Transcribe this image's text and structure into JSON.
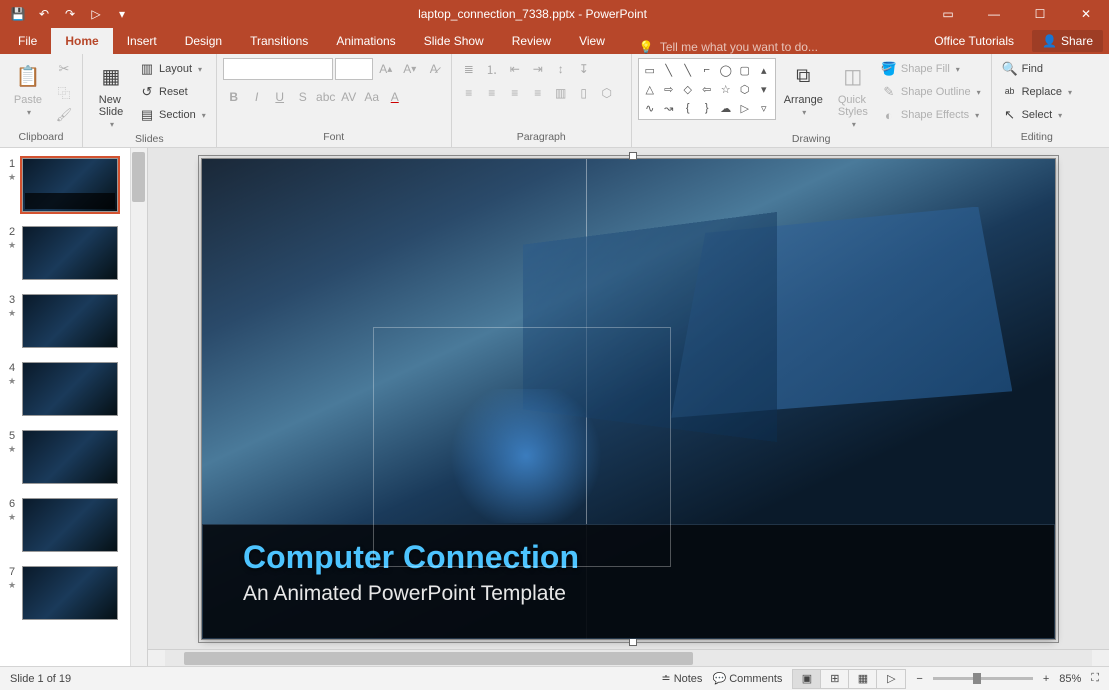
{
  "app": {
    "title": "laptop_connection_7338.pptx - PowerPoint"
  },
  "qat": {
    "save": "💾",
    "undo": "↶",
    "redo": "↷",
    "start": "▷",
    "more": "▾"
  },
  "tabs": {
    "file": "File",
    "home": "Home",
    "insert": "Insert",
    "design": "Design",
    "transitions": "Transitions",
    "animations": "Animations",
    "slideshow": "Slide Show",
    "review": "Review",
    "view": "View"
  },
  "tellme": {
    "placeholder": "Tell me what you want to do..."
  },
  "rightTabs": {
    "tutorials": "Office Tutorials",
    "share": "Share"
  },
  "ribbon": {
    "clipboard": {
      "label": "Clipboard",
      "paste": "Paste",
      "cut": "✂",
      "copy": "⿻",
      "painter": "🖌"
    },
    "slides": {
      "label": "Slides",
      "newSlide": "New\nSlide",
      "layout": "Layout",
      "reset": "Reset",
      "section": "Section"
    },
    "font": {
      "label": "Font"
    },
    "paragraph": {
      "label": "Paragraph"
    },
    "drawing": {
      "label": "Drawing",
      "arrange": "Arrange",
      "quickStyles": "Quick\nStyles",
      "shapeFill": "Shape Fill",
      "shapeOutline": "Shape Outline",
      "shapeEffects": "Shape Effects"
    },
    "editing": {
      "label": "Editing",
      "find": "Find",
      "replace": "Replace",
      "select": "Select"
    }
  },
  "thumbs": [
    1,
    2,
    3,
    4,
    5,
    6,
    7
  ],
  "slide": {
    "title": "Computer Connection",
    "subtitle": "An Animated PowerPoint Template"
  },
  "status": {
    "slideInfo": "Slide 1 of 19",
    "notes": "Notes",
    "comments": "Comments",
    "zoom": "85%"
  }
}
